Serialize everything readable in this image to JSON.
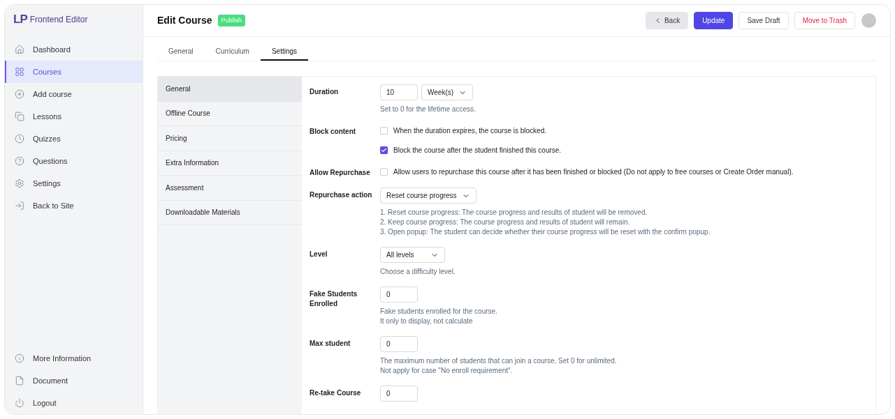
{
  "brand": {
    "mark": "LP",
    "name": "Frontend Editor"
  },
  "sidebar": {
    "items": [
      {
        "kind": "home",
        "label": "Dashboard",
        "selected": false
      },
      {
        "kind": "grid",
        "label": "Courses",
        "selected": true
      },
      {
        "kind": "plus",
        "label": "Add course",
        "selected": false
      },
      {
        "kind": "copy",
        "label": "Lessons",
        "selected": false
      },
      {
        "kind": "clock",
        "label": "Quizzes",
        "selected": false
      },
      {
        "kind": "help",
        "label": "Questions",
        "selected": false
      },
      {
        "kind": "gear",
        "label": "Settings",
        "selected": false
      },
      {
        "kind": "exit",
        "label": "Back to Site",
        "selected": false
      }
    ],
    "bottom_items": [
      {
        "kind": "info",
        "label": "More Information",
        "selected": false
      },
      {
        "kind": "file",
        "label": "Document",
        "selected": false
      },
      {
        "kind": "power",
        "label": "Logout",
        "selected": false
      }
    ]
  },
  "header": {
    "title": "Edit Course",
    "status": "Publish",
    "buttons": [
      {
        "kind": "back",
        "label": "Back"
      },
      {
        "kind": "primary",
        "label": "Update"
      },
      {
        "kind": "plain",
        "label": "Save Draft"
      },
      {
        "kind": "danger",
        "label": "Move to Trash"
      }
    ]
  },
  "tabs": [
    {
      "label": "General",
      "selected": false
    },
    {
      "label": "Curriculum",
      "selected": false
    },
    {
      "label": "Settings",
      "selected": true
    }
  ],
  "settings_menu": [
    {
      "label": "General",
      "selected": true
    },
    {
      "label": "Offline Course",
      "selected": false
    },
    {
      "label": "Pricing",
      "selected": false
    },
    {
      "label": "Extra Information",
      "selected": false
    },
    {
      "label": "Assessment",
      "selected": false
    },
    {
      "label": "Downloadable Materials",
      "selected": false
    }
  ],
  "fields": [
    {
      "kind": "duration",
      "label": "Duration",
      "value": "10",
      "unit": "Week(s)",
      "help": [
        "Set to 0 for the lifetime access."
      ]
    },
    {
      "kind": "checks",
      "label": "Block content",
      "options": [
        {
          "label": "When the duration expires, the course is blocked.",
          "checked": false
        },
        {
          "label": "Block the course after the student finished this course.",
          "checked": true
        }
      ]
    },
    {
      "kind": "checks",
      "label": "Allow Repurchase",
      "options": [
        {
          "label": "Allow users to repurchase this course after it has been finished or blocked (Do not apply to free courses or Create Order manual).",
          "checked": false
        }
      ]
    },
    {
      "kind": "select",
      "label": "Repurchase action",
      "value": "Reset course progress",
      "help": [
        "1. Reset course progress: The course progress and results of student will be removed.",
        "2. Keep course progress: The course progress and results of student will remain.",
        "3. Open popup: The student can decide whether their course progress will be reset with the confirm popup."
      ]
    },
    {
      "kind": "select",
      "label": "Level",
      "value": "All levels",
      "help": [
        "Choose a difficulty level."
      ]
    },
    {
      "kind": "number",
      "label": "Fake Students Enrolled",
      "value": "0",
      "help": [
        "Fake students enrolled for the course.",
        "It only to display, not calculate"
      ]
    },
    {
      "kind": "number",
      "label": "Max student",
      "value": "0",
      "help": [
        "The maximum number of students that can join a course. Set 0 for unlimited.",
        "Not apply for case \"No enroll requirement\"."
      ]
    },
    {
      "kind": "number",
      "label": "Re-take Course",
      "value": "0"
    }
  ]
}
